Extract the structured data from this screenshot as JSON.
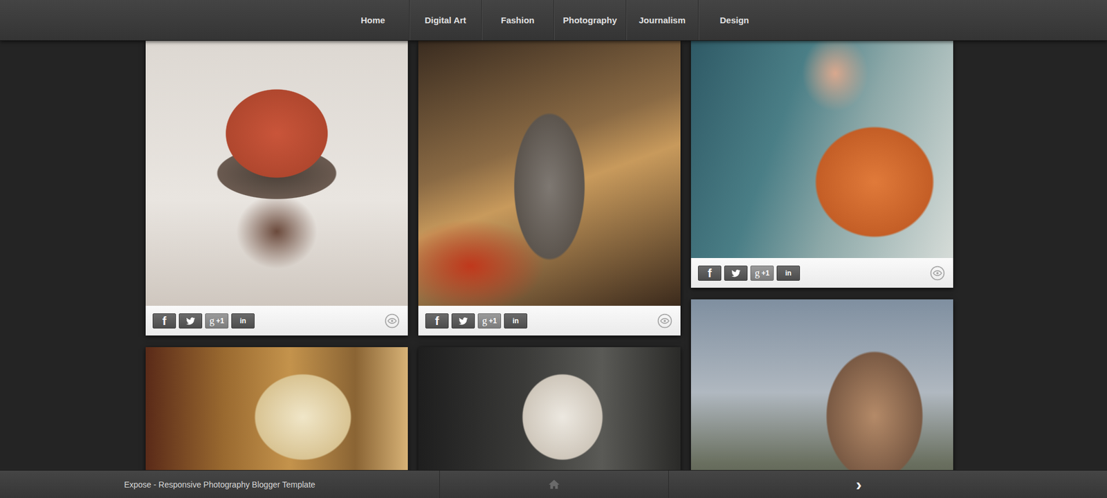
{
  "nav": {
    "items": [
      {
        "label": "Home",
        "selected": false
      },
      {
        "label": "Digital Art",
        "selected": false
      },
      {
        "label": "Fashion",
        "selected": false
      },
      {
        "label": "Photography",
        "selected": false
      },
      {
        "label": "Journalism",
        "selected": false
      },
      {
        "label": "Design",
        "selected": false
      }
    ]
  },
  "posts": [
    {
      "kind": "photo",
      "share_bar": true
    },
    {
      "kind": "photo",
      "share_bar": true
    },
    {
      "kind": "photo",
      "share_bar": true
    },
    {
      "kind": "photo",
      "share_bar": false
    },
    {
      "kind": "photo",
      "share_bar": false
    },
    {
      "kind": "photo",
      "share_bar": false
    }
  ],
  "share_buttons": [
    {
      "kind": "facebook",
      "glyph": "f",
      "label": ""
    },
    {
      "kind": "twitter",
      "glyph": "",
      "label": ""
    },
    {
      "kind": "gplus",
      "glyph": "g",
      "label": "+1"
    },
    {
      "kind": "linkedin",
      "glyph": "",
      "label": "in"
    }
  ],
  "footer": {
    "title": "Expose - Responsive Photography Blogger Template",
    "next": "›"
  }
}
